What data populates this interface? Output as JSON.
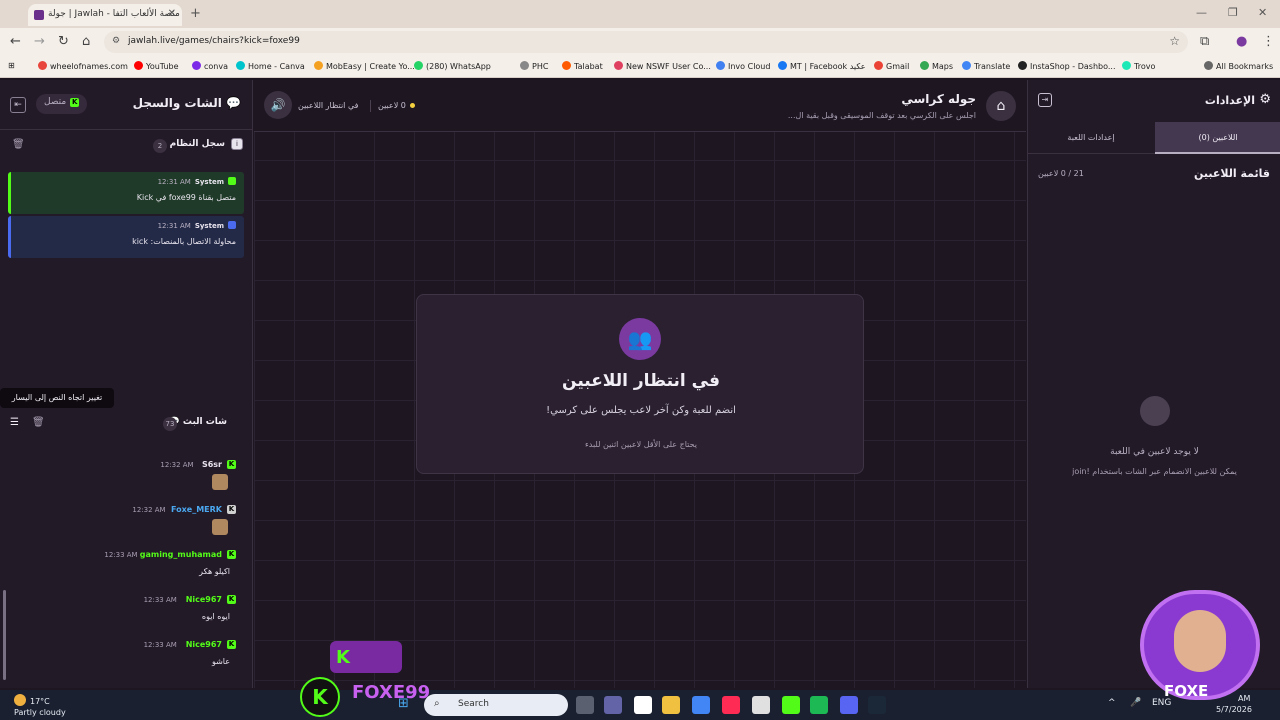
{
  "browser": {
    "tab_title": "جولة | Jawlah - منصة الألعاب التفا",
    "url": "jawlah.live/games/chairs?kick=foxe99",
    "bookmarks": [
      "wheelofnames.com",
      "YouTube",
      "conva",
      "Home - Canva",
      "MobEasy | Create Yo...",
      "(280) WhatsApp",
      "PHC",
      "Talabat",
      "New NSWF User Co...",
      "Invo Cloud",
      "MT | Facebook عكيد",
      "Gmail",
      "Maps",
      "Translate",
      "InstaShop - Dashbo...",
      "Trovo",
      "All Bookmarks"
    ],
    "bookmark_colors": [
      "#e8453c",
      "#ff0000",
      "#7d2ae8",
      "#00c4cc",
      "#f4a020",
      "#25d366",
      "#888888",
      "#ff5a00",
      "#e04060",
      "#4080f0",
      "#1877f2",
      "#ea4335",
      "#34a853",
      "#4285f4",
      "#222222",
      "#1de9b6",
      "#666666"
    ]
  },
  "left_panel": {
    "title": "الشات والسجل",
    "connection_status": "متصل",
    "system_log": {
      "title": "سجل النظام",
      "count": "2",
      "messages": [
        {
          "sender": "System",
          "time": "12:31 AM",
          "text": "متصل بقناة foxe99 في Kick",
          "color": "#1f3a28",
          "border": "#53fc18"
        },
        {
          "sender": "System",
          "time": "12:31 AM",
          "text": "محاولة الاتصال بالمنصات: kick",
          "color": "#232a48",
          "border": "#4a6af0"
        }
      ]
    },
    "tooltip": "تغيير اتجاه النص إلى اليسار",
    "live_chat": {
      "title": "شات البث",
      "count": "73",
      "messages": [
        {
          "user": "S6sr",
          "time": "12:32 AM",
          "text": "",
          "emote": true,
          "user_color": "#e8e4ee"
        },
        {
          "user": "Foxe_MERK",
          "time": "12:32 AM",
          "text": "",
          "emote": true,
          "user_color": "#4aa8f0"
        },
        {
          "user": "gaming_muhamad",
          "time": "12:33 AM",
          "text": "اكيلو هكر",
          "emote": false,
          "user_color": "#53fc18"
        },
        {
          "user": "Nice967",
          "time": "12:33 AM",
          "text": "ايوه ايوه",
          "emote": false,
          "user_color": "#53fc18"
        },
        {
          "user": "Nice967",
          "time": "12:33 AM",
          "text": "عاشو",
          "emote": false,
          "user_color": "#53fc18"
        }
      ]
    }
  },
  "center": {
    "game_title": "جوله كراسي",
    "game_desc": "اجلس على الكرسي بعد توقف الموسيقى وقبل بقية ال...",
    "status": "في انتظار اللاعبين",
    "player_count": "0 لاعبين",
    "card_title": "في انتظار اللاعبين",
    "card_sub": "انضم للعبة وكن آخر لاعب يجلس على كرسي!",
    "card_hint": "يحتاج على الأقل لاعبين اثنين للبدء"
  },
  "right_panel": {
    "title": "الإعدادات",
    "tab_players": "اللاعبين (0)",
    "tab_settings": "إعدادات اللعبة",
    "list_title": "قائمة اللاعبين",
    "list_count": "21 / 0 لاعبين",
    "empty": "لا يوجد لاعبين في اللعبة",
    "empty_sub": "يمكن للاعبين الانضمام عبر الشات باستخدام !join"
  },
  "overlay": {
    "brand": "FOXE99",
    "cam_label": "FOXE"
  },
  "taskbar": {
    "temp": "17°C",
    "weather": "Partly cloudy",
    "search": "Search",
    "lang": "ENG",
    "time": "AM",
    "date": "5/7/2026",
    "icon_colors": [
      "#5a6070",
      "#6264a7",
      "#ffffff",
      "#f0c040",
      "#4285f4",
      "#fe2c55",
      "#e0e0e0",
      "#53fc18",
      "#1db954",
      "#5865f2",
      "#1b2838"
    ]
  },
  "accent": "#53fc18",
  "purple": "#7a3aa0"
}
